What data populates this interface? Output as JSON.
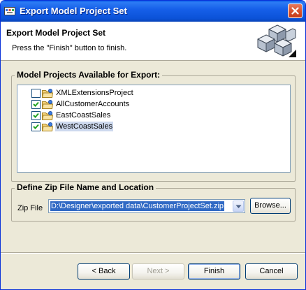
{
  "window": {
    "title": "Export Model Project Set",
    "icon": "app-icon",
    "close_icon": "close-icon"
  },
  "header": {
    "title": "Export Model Project Set",
    "description": "Press the \"Finish\" button to finish.",
    "graphic": "cubes-icon"
  },
  "projects": {
    "legend": "Model Projects Available for Export:",
    "items": [
      {
        "label": "XMLExtensionsProject",
        "checked": false,
        "selected": false
      },
      {
        "label": "AllCustomerAccounts",
        "checked": true,
        "selected": false
      },
      {
        "label": "EastCoastSales",
        "checked": true,
        "selected": false
      },
      {
        "label": "WestCoastSales",
        "checked": true,
        "selected": true
      }
    ]
  },
  "zip": {
    "legend": "Define Zip File Name and Location",
    "label": "Zip File",
    "value": "D:\\Designer\\exported data\\CustomerProjectSet.zip",
    "browse_label": "Browse..."
  },
  "buttons": {
    "back": "< Back",
    "next": "Next >",
    "finish": "Finish",
    "cancel": "Cancel"
  },
  "colors": {
    "titlebar": "#0b52d8",
    "selection": "#316ac5",
    "dialog_bg": "#ece9d8"
  }
}
